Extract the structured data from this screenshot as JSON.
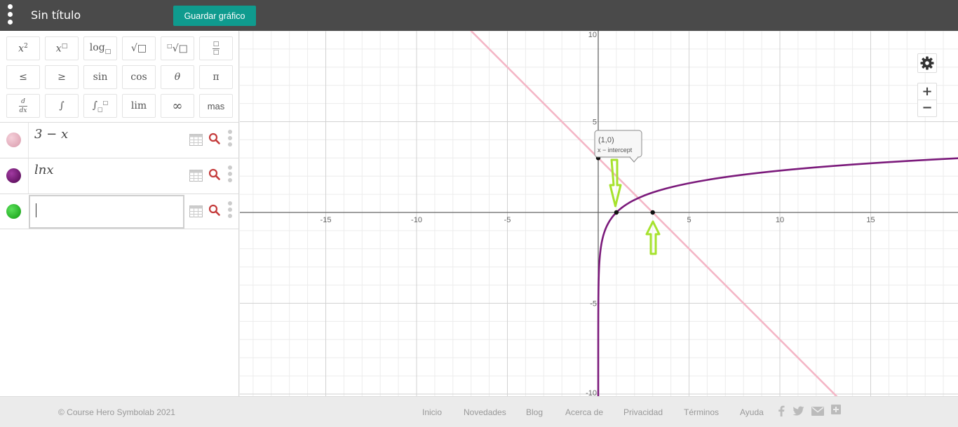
{
  "header": {
    "title": "Sin título",
    "save_label": "Guardar gráfico"
  },
  "keypad": {
    "rows": [
      [
        "x²",
        "x□",
        "log□",
        "√□",
        "□√□",
        "□/□"
      ],
      [
        "≤",
        "≥",
        "sin",
        "cos",
        "θ",
        "π"
      ],
      [
        "d/dx",
        "∫",
        "∫□□",
        "lim",
        "∞",
        "mas"
      ]
    ]
  },
  "expressions": [
    {
      "text": "3 − x",
      "color": "#e2a9b8"
    },
    {
      "text": "lnx",
      "color": "#6b0e6b"
    },
    {
      "text": "",
      "color": "#1bb51b"
    }
  ],
  "graph": {
    "x_ticks": [
      "-15",
      "-10",
      "-5",
      "5",
      "10",
      "15"
    ],
    "y_ticks": [
      "10",
      "5",
      "-5",
      "-10"
    ],
    "tooltip": {
      "point": "(1,0)",
      "label": "x − intercept"
    },
    "controls": {
      "settings": "gear-icon",
      "zoom_in": "+",
      "zoom_out": "−"
    }
  },
  "chart_data": {
    "type": "line",
    "xlim": [
      -19.2,
      19.6
    ],
    "ylim": [
      -10,
      10
    ],
    "series": [
      {
        "name": "3 − x",
        "function": "3-x",
        "color": "#f4b6c6"
      },
      {
        "name": "lnx",
        "function": "ln(x)",
        "color": "#7b1a7b"
      }
    ],
    "points": [
      {
        "x": 1,
        "y": 0
      },
      {
        "x": 3,
        "y": 0
      },
      {
        "x": 0,
        "y": 3
      }
    ],
    "annotation_color": "#a6e22e",
    "grid": true
  },
  "footer": {
    "copyright": "© Course Hero Symbolab 2021",
    "links": [
      "Inicio",
      "Novedades",
      "Blog",
      "Acerca de",
      "Privacidad",
      "Términos",
      "Ayuda"
    ],
    "social": [
      "facebook-icon",
      "twitter-icon",
      "mail-icon",
      "plus-icon"
    ]
  }
}
